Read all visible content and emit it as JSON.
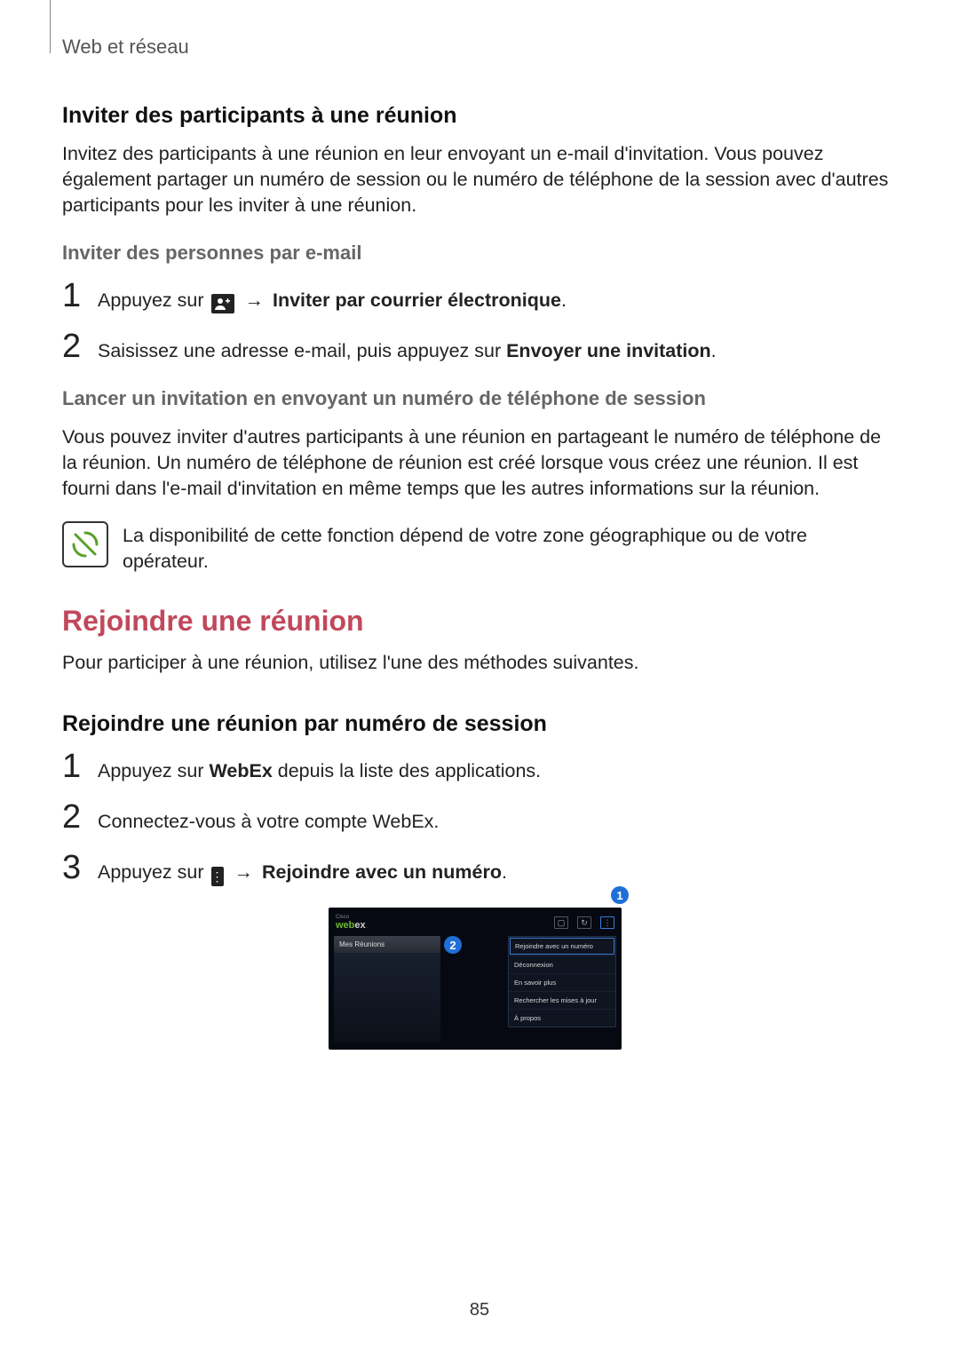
{
  "header": "Web et réseau",
  "s1": {
    "title": "Inviter des participants à une réunion",
    "intro": "Invitez des participants à une réunion en leur envoyant un e-mail d'invitation. Vous pouvez également partager un numéro de session ou le numéro de téléphone de la session avec d'autres participants pour les inviter à une réunion.",
    "sub_email": "Inviter des personnes par e-mail",
    "step1_a": "Appuyez sur",
    "step1_b": "Inviter par courrier électronique",
    "step1_c": ".",
    "step2_a": "Saisissez une adresse e-mail, puis appuyez sur ",
    "step2_b": "Envoyer une invitation",
    "step2_c": ".",
    "sub_phone": "Lancer un invitation en envoyant un numéro de téléphone de session",
    "phone_body": "Vous pouvez inviter d'autres participants à une réunion en partageant le numéro de téléphone de la réunion. Un numéro de téléphone de réunion est créé lorsque vous créez une réunion. Il est fourni dans l'e-mail d'invitation en même temps que les autres informations sur la réunion.",
    "note": "La disponibilité de cette fonction dépend de votre zone géographique ou de votre opérateur."
  },
  "s2": {
    "title": "Rejoindre une réunion",
    "intro": "Pour participer à une réunion, utilisez l'une des méthodes suivantes.",
    "sub": "Rejoindre une réunion par numéro de session",
    "step1_a": "Appuyez sur ",
    "step1_b": "WebEx",
    "step1_c": " depuis la liste des applications.",
    "step2": "Connectez-vous à votre compte WebEx.",
    "step3_a": "Appuyez sur",
    "step3_b": "Rejoindre avec un numéro",
    "step3_c": "."
  },
  "arrow": "→",
  "nums": {
    "n1": "1",
    "n2": "2",
    "n3": "3"
  },
  "callouts": {
    "c1": "1",
    "c2": "2"
  },
  "shot": {
    "logo_top": "Cisco",
    "logo_a": "web",
    "logo_b": "ex",
    "tab": "Mes Réunions",
    "menu": [
      "Rejoindre avec un numéro",
      "Déconnexion",
      "En savoir plus",
      "Rechercher les mises à jour",
      "À propos"
    ]
  },
  "page_number": "85"
}
